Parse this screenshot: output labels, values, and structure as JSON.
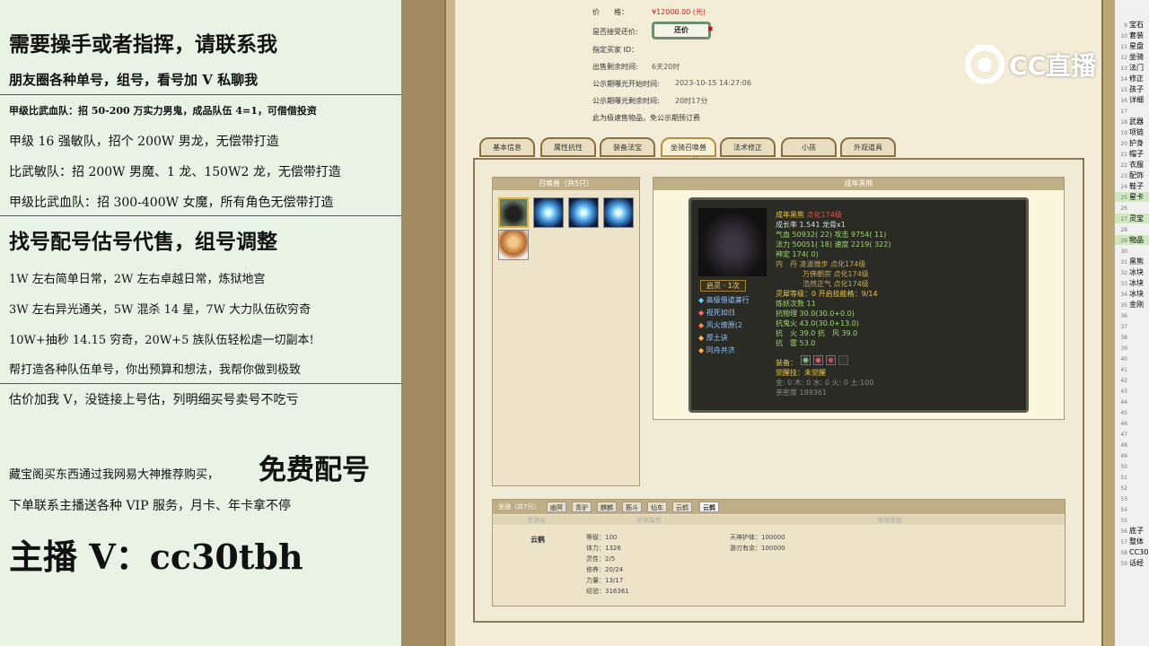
{
  "left_ad": {
    "lines": [
      "需要操手或者指挥，请联系我",
      "朋友圈各种单号，组号，看号加 V 私聊我",
      "甲级比武血队：招 50-200 万实力男鬼，成品队伍 4=1，可借借投资",
      "甲级 16 强敏队，招个 200W 男龙，无偿带打造",
      "比武敏队：招 200W 男魔、1 龙、150W2 龙，无偿带打造",
      "甲级比武血队：招 300-400W 女魔，所有角色无偿带打造",
      "找号配号估号代售，组号调整",
      "1W 左右简单日常，2W 左右卓越日常，炼狱地宫",
      "3W 左右异光通关，5W 混杀 14 星，7W 大力队伍砍穷奇",
      "10W+抽秒 14.15 穷奇，20W+5 族队伍轻松虐一切副本!",
      "帮打造各种队伍单号，你出预算和想法，我帮你做到极致",
      "估价加我 V，没链接上号估，列明细买号卖号不吃亏",
      "藏宝阁买东西通过我网易大神推荐购买，",
      "免费配号",
      "下单联系主播送各种 VIP 服务，月卡、年卡拿不停",
      "主播 V：cc30tbh"
    ]
  },
  "sale_info": {
    "price_label": "价　　格：",
    "price_value": "¥12000.00 (元)",
    "counter_label": "是否接受还价:",
    "counter_button": "还价",
    "counter_close": "✖",
    "buyer_label": "指定买家 ID：",
    "remain_label": "出售剩余时间:",
    "remain_value": "6天20时",
    "start_label": "公示期曝光开始时间:",
    "start_value": "2023-10-15 14:27:06",
    "expose_label": "公示期曝光剩余时间:",
    "expose_value": "20时17分",
    "note": "此为极速售物品，免公示期预订费"
  },
  "tabs": [
    "基本信息",
    "属性抗性",
    "装备法宝",
    "坐骑召唤兽",
    "法术修正",
    "小孩",
    "外观道具"
  ],
  "active_tab": "坐骑召唤兽",
  "summon_box": {
    "title": "召唤兽（共5只）"
  },
  "detail_box": {
    "title": "成年黑熊"
  },
  "pet_card": {
    "name": "成年黑熊",
    "name_suffix": "点化174级",
    "growth": "成长率 1.541 龙骨x1",
    "hp": "气血 50932( 22) 攻击 9754( 11)",
    "mp": "法力 50051( 18) 速度 2219( 322)",
    "shen": "神定 174( 0)",
    "neidan1": "内　丹 凌波微步 点化174级",
    "neidan2": "万佛朝宗 点化174级",
    "neidan3": "浩然正气 点化174级",
    "lingxi": "灵犀等级：0 开启技能格：9/14",
    "lianyao": "炼妖次数 11",
    "kangwl": "抗物理 30.0(30.0+0.0)",
    "kanggh": "抗鬼火 43.0(30.0+13.0)",
    "kanghf": "抗　火 39.0 抗　风 39.0",
    "kangl": "抗　雷 53.0",
    "qiling": "启灵 · 1次",
    "skills": [
      "高级借道兼行",
      "视死如归",
      "风火燎原(2",
      "厚土诀",
      "同舟共济"
    ],
    "equip_label": "装备：",
    "awaken": "觉醒技：未觉醒",
    "elements": "金: 0 木: 0 水: 0 火: 0 土:100",
    "intimacy": "亲密度 189361"
  },
  "mount_box": {
    "title": "坐骑（共7只）",
    "tabs": [
      "幽冥",
      "青驴",
      "麒麟",
      "筋斗",
      "仙车",
      "云鹤",
      "云鹤"
    ],
    "col_name": "坐骑名",
    "col_attr": "坐骑属性",
    "col_skill": "坐骑技能",
    "name": "云鹤",
    "attrs": [
      "等级：100",
      "体力：1326",
      "灵性：2/5",
      "修养：20/24",
      "力量：13/17",
      "经验：316361"
    ],
    "skills": [
      "天神护体：100000",
      "游刃有余：100000"
    ]
  },
  "watermark": "CC直播",
  "right_panel": {
    "rows": [
      {
        "n": "9",
        "t": "宝石"
      },
      {
        "n": "10",
        "t": "套装"
      },
      {
        "n": "11",
        "t": "星盘"
      },
      {
        "n": "12",
        "t": "坐骑"
      },
      {
        "n": "13",
        "t": "法门"
      },
      {
        "n": "14",
        "t": "修正"
      },
      {
        "n": "15",
        "t": "孩子"
      },
      {
        "n": "16",
        "t": "详细"
      },
      {
        "n": "17",
        "t": ""
      },
      {
        "n": "18",
        "t": "武器"
      },
      {
        "n": "19",
        "t": "项链"
      },
      {
        "n": "20",
        "t": "护身"
      },
      {
        "n": "21",
        "t": "帽子"
      },
      {
        "n": "22",
        "t": "衣服"
      },
      {
        "n": "23",
        "t": "配饰"
      },
      {
        "n": "24",
        "t": "鞋子"
      },
      {
        "n": "25",
        "t": "星卡"
      },
      {
        "n": "26",
        "t": ""
      },
      {
        "n": "27",
        "t": "灵宝"
      },
      {
        "n": "28",
        "t": ""
      },
      {
        "n": "29",
        "t": "物品"
      },
      {
        "n": "30",
        "t": ""
      },
      {
        "n": "31",
        "t": "黑熊"
      },
      {
        "n": "32",
        "t": "冰块"
      },
      {
        "n": "33",
        "t": "冰块"
      },
      {
        "n": "34",
        "t": "冰块"
      },
      {
        "n": "35",
        "t": "金刚"
      },
      {
        "n": "36",
        "t": ""
      },
      {
        "n": "37",
        "t": ""
      },
      {
        "n": "38",
        "t": ""
      },
      {
        "n": "39",
        "t": ""
      },
      {
        "n": "40",
        "t": ""
      },
      {
        "n": "41",
        "t": ""
      },
      {
        "n": "42",
        "t": ""
      },
      {
        "n": "43",
        "t": ""
      },
      {
        "n": "44",
        "t": ""
      },
      {
        "n": "45",
        "t": ""
      },
      {
        "n": "46",
        "t": ""
      },
      {
        "n": "47",
        "t": ""
      },
      {
        "n": "48",
        "t": ""
      },
      {
        "n": "49",
        "t": ""
      },
      {
        "n": "50",
        "t": ""
      },
      {
        "n": "51",
        "t": ""
      },
      {
        "n": "52",
        "t": ""
      },
      {
        "n": "53",
        "t": ""
      },
      {
        "n": "54",
        "t": ""
      },
      {
        "n": "55",
        "t": ""
      },
      {
        "n": "56",
        "t": "底子"
      },
      {
        "n": "57",
        "t": "整体"
      },
      {
        "n": "58",
        "t": "CC30"
      },
      {
        "n": "59",
        "t": "话经"
      }
    ]
  },
  "colors": {
    "price_red": "#d01c1c",
    "pet_yellow": "#e8c84a",
    "pet_green": "#9bd96b",
    "active_tab": "#b59040"
  }
}
